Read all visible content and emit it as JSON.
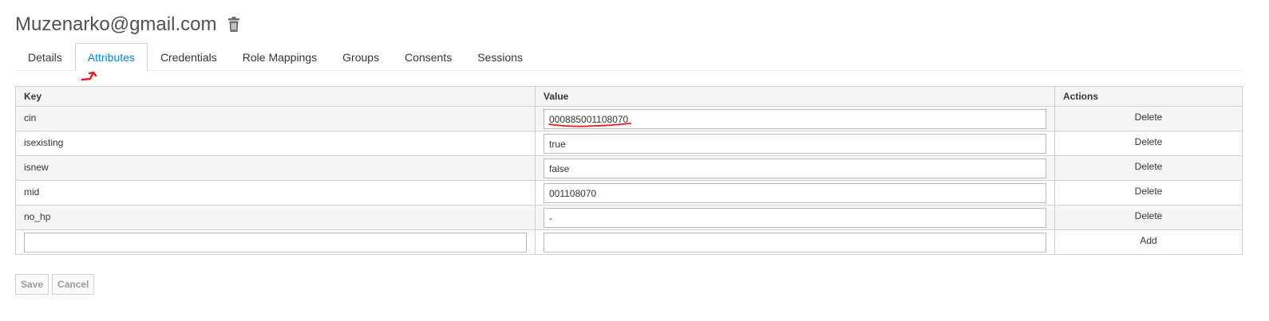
{
  "header": {
    "title": "Muzenarko@gmail.com",
    "delete_icon": "trash-icon"
  },
  "tabs": [
    {
      "label": "Details",
      "active": false
    },
    {
      "label": "Attributes",
      "active": true
    },
    {
      "label": "Credentials",
      "active": false
    },
    {
      "label": "Role Mappings",
      "active": false
    },
    {
      "label": "Groups",
      "active": false
    },
    {
      "label": "Consents",
      "active": false
    },
    {
      "label": "Sessions",
      "active": false
    }
  ],
  "table": {
    "columns": [
      "Key",
      "Value",
      "Actions"
    ],
    "rows": [
      {
        "key": "cin",
        "value": "000885001108070",
        "action": "Delete"
      },
      {
        "key": "isexisting",
        "value": "true",
        "action": "Delete"
      },
      {
        "key": "isnew",
        "value": "false",
        "action": "Delete"
      },
      {
        "key": "mid",
        "value": "001108070",
        "action": "Delete"
      },
      {
        "key": "no_hp",
        "value": "-",
        "action": "Delete"
      }
    ],
    "new_row": {
      "key": "",
      "value": "",
      "action": "Add"
    }
  },
  "buttons": {
    "save": "Save",
    "cancel": "Cancel"
  },
  "colors": {
    "accent": "#0088ce",
    "annotation": "#e02020"
  }
}
